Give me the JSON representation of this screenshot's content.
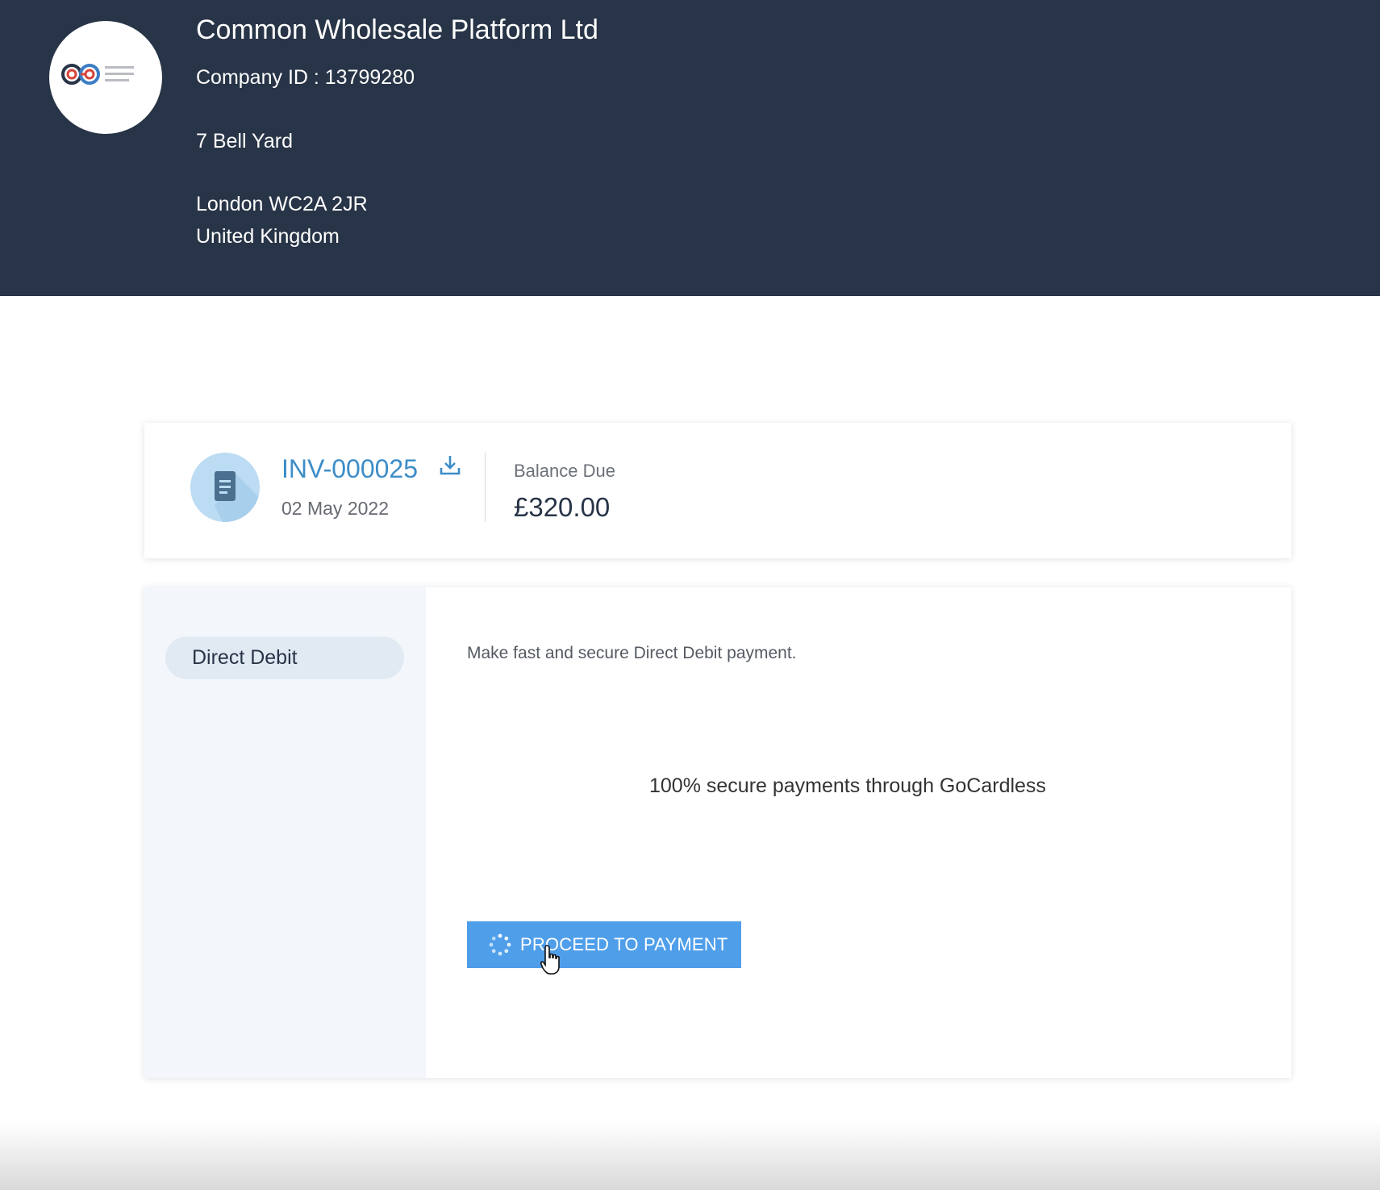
{
  "header": {
    "logo_name": "common-wholesale-platform-logo",
    "company_name": "Common Wholesale Platform Ltd",
    "company_id": "Company ID : 13799280",
    "address": {
      "line1": "7 Bell Yard",
      "line2": "London WC2A 2JR",
      "line3": "United Kingdom"
    },
    "background_color": "#283447"
  },
  "invoice": {
    "icon": "document-icon",
    "number": "INV-000025",
    "download_icon": "download-icon",
    "date": "02 May 2022",
    "balance_label": "Balance Due",
    "balance_amount": "£320.00"
  },
  "payment": {
    "methods": [
      {
        "label": "Direct Debit",
        "selected": true
      }
    ],
    "description": "Make fast and secure Direct Debit payment.",
    "secure_note": "100% secure payments through GoCardless",
    "proceed_button": {
      "label": "PROCEED TO PAYMENT",
      "loading": true,
      "icon": "spinner-icon"
    },
    "accent_color": "#4f9eea"
  }
}
